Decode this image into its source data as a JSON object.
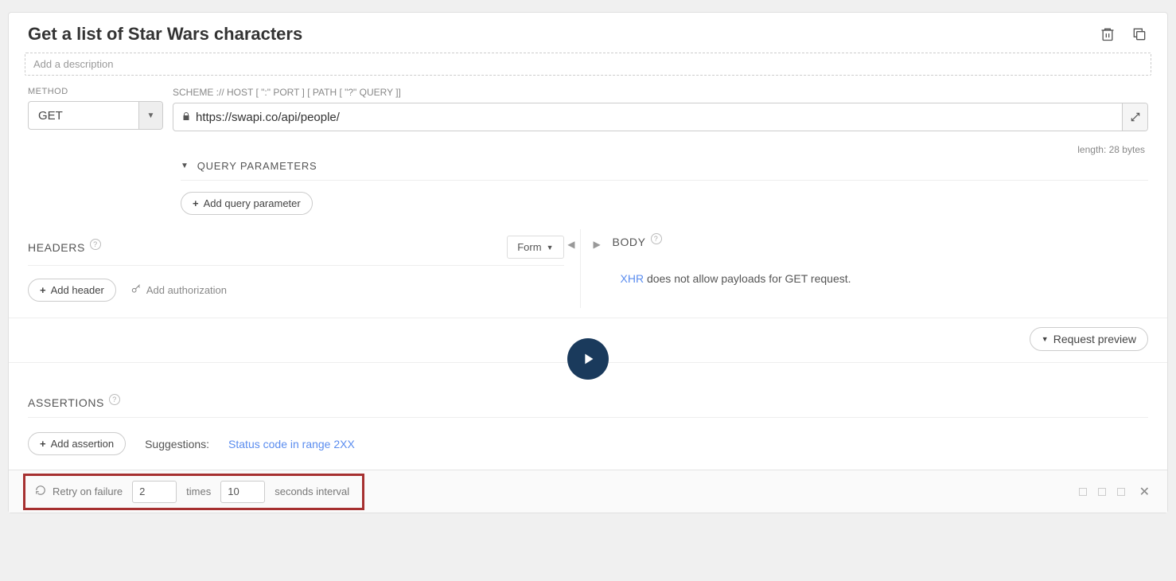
{
  "title": "Get a list of Star Wars characters",
  "description_placeholder": "Add a description",
  "method_label": "METHOD",
  "method_value": "GET",
  "scheme_label": "SCHEME :// HOST [ \":\" PORT ] [ PATH [ \"?\" QUERY ]]",
  "url_value": "https://swapi.co/api/people/",
  "length_text": "length: 28 bytes",
  "query_parameters_label": "QUERY PARAMETERS",
  "add_query_parameter_label": "Add query parameter",
  "headers_label": "HEADERS",
  "form_label": "Form",
  "add_header_label": "Add header",
  "add_authorization_label": "Add authorization",
  "body_label": "BODY",
  "body_xhr": "XHR",
  "body_msg_rest": " does not allow payloads for GET request.",
  "request_preview_label": "Request preview",
  "assertions_label": "ASSERTIONS",
  "add_assertion_label": "Add assertion",
  "suggestions_label": "Suggestions:",
  "suggestion_link": "Status code in range 2XX",
  "retry_label": "Retry on failure",
  "retry_times_value": "2",
  "retry_times_label": "times",
  "retry_interval_value": "10",
  "retry_interval_label": "seconds interval"
}
